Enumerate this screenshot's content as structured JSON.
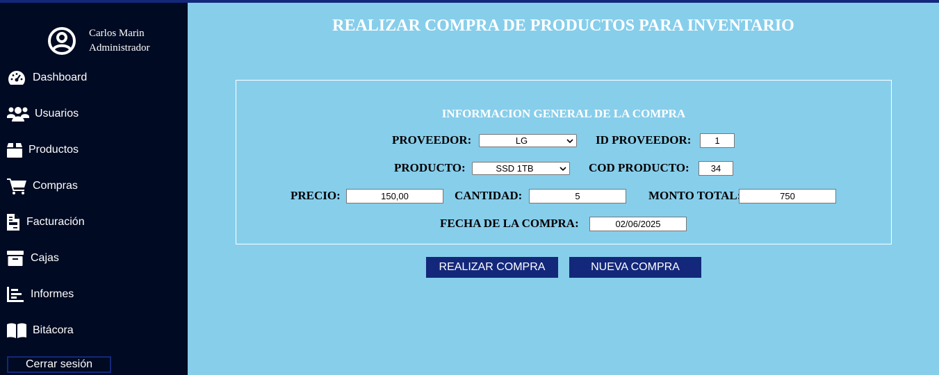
{
  "user": {
    "name": "Carlos Marin",
    "role": "Administrador"
  },
  "sidebar": {
    "items": [
      {
        "label": "Dashboard",
        "icon": "gauge-icon"
      },
      {
        "label": "Usuarios",
        "icon": "users-icon"
      },
      {
        "label": "Productos",
        "icon": "box-icon"
      },
      {
        "label": "Compras",
        "icon": "cart-icon"
      },
      {
        "label": "Facturación",
        "icon": "invoice-icon"
      },
      {
        "label": "Cajas",
        "icon": "archive-icon"
      },
      {
        "label": "Informes",
        "icon": "chart-icon"
      },
      {
        "label": "Bitácora",
        "icon": "book-icon"
      }
    ],
    "logout_label": "Cerrar sesión"
  },
  "page": {
    "title": "REALIZAR COMPRA DE PRODUCTOS PARA INVENTARIO"
  },
  "form": {
    "section_title": "INFORMACION GENERAL DE LA COMPRA",
    "proveedor_label": "PROVEEDOR:",
    "proveedor_value": "LG",
    "id_proveedor_label": "ID PROVEEDOR:",
    "id_proveedor_value": "1",
    "producto_label": "PRODUCTO:",
    "producto_value": "SSD 1TB",
    "cod_producto_label": "COD PRODUCTO:",
    "cod_producto_value": "34",
    "precio_label": "PRECIO:",
    "precio_value": "150,00",
    "cantidad_label": "CANTIDAD:",
    "cantidad_value": "5",
    "monto_label": "MONTO TOTAL:",
    "monto_value": "750",
    "fecha_label": "FECHA DE LA COMPRA:",
    "fecha_value": "02/06/2025"
  },
  "actions": {
    "submit_label": "REALIZAR COMPRA",
    "new_label": "NUEVA COMPRA"
  },
  "colors": {
    "sidebar_bg": "#000a22",
    "main_bg": "#87ceeb",
    "accent": "#13287a"
  }
}
